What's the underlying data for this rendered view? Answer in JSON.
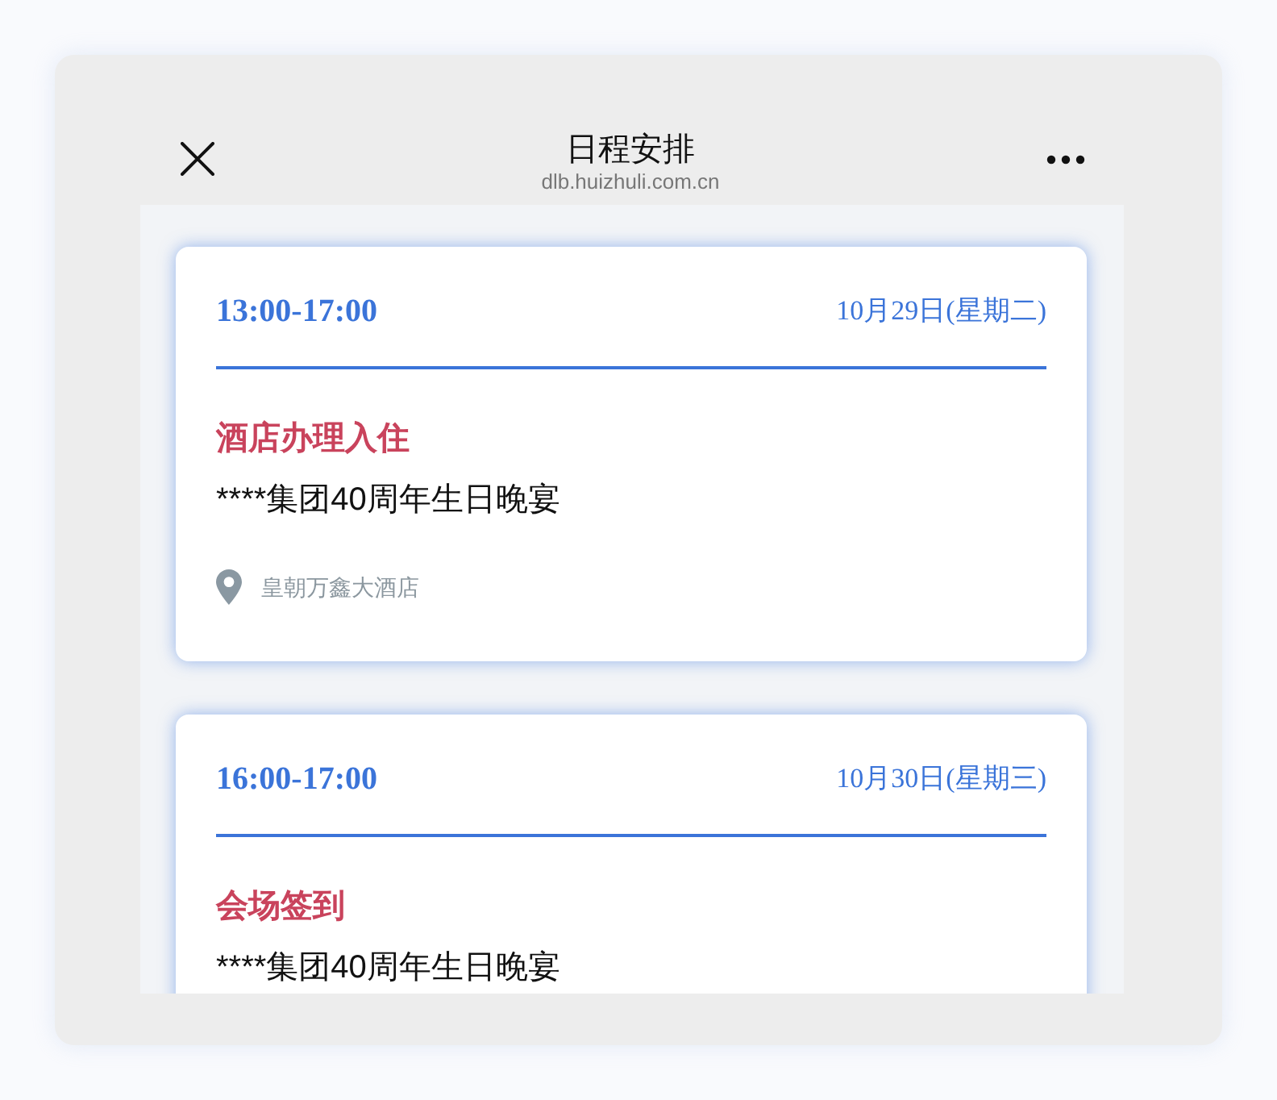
{
  "header": {
    "title": "日程安排",
    "url": "dlb.huizhuli.com.cn"
  },
  "events": [
    {
      "time": "13:00-17:00",
      "date": "10月29日(星期二)",
      "title": "酒店办理入住",
      "subtitle": "****集团40周年生日晚宴",
      "location": "皇朝万鑫大酒店"
    },
    {
      "time": "16:00-17:00",
      "date": "10月30日(星期三)",
      "title": "会场签到",
      "subtitle": "****集团40周年生日晚宴"
    }
  ]
}
